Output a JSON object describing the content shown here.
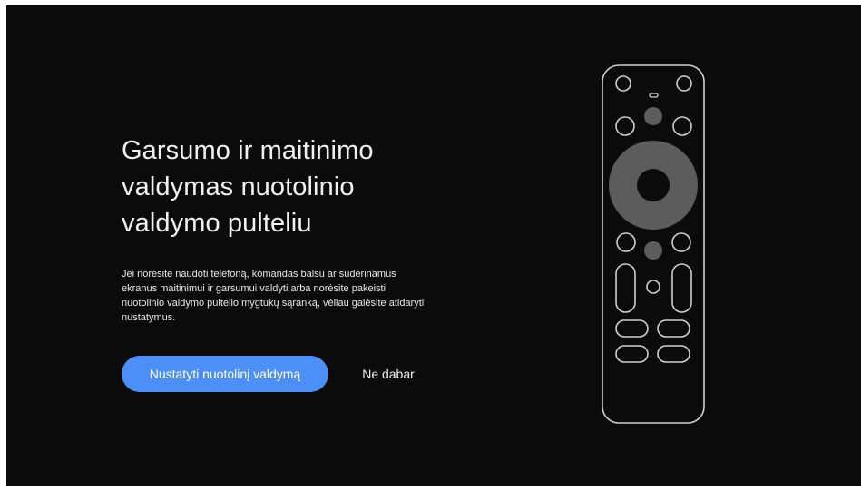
{
  "setup": {
    "title": "Garsumo ir maitinimo valdymas nuotolinio valdymo pulteliu",
    "description": "Jei norėsite naudoti telefoną, komandas balsu ar suderinamus ekranus maitinimui ir garsumui valdyti arba norėsite pakeisti nuotolinio valdymo pultelio mygtukų sąranką, vėliau galėsite atidaryti nustatymus.",
    "primary_button": "Nustatyti nuotolinį valdymą",
    "secondary_button": "Ne dabar",
    "illustration": "remote-control-illustration"
  },
  "colors": {
    "background": "#0b0b0b",
    "accent": "#4b8ff7",
    "text": "#f1f1f1",
    "remote_outline": "#d0d0d0",
    "remote_fill": "#5c5c5c"
  }
}
